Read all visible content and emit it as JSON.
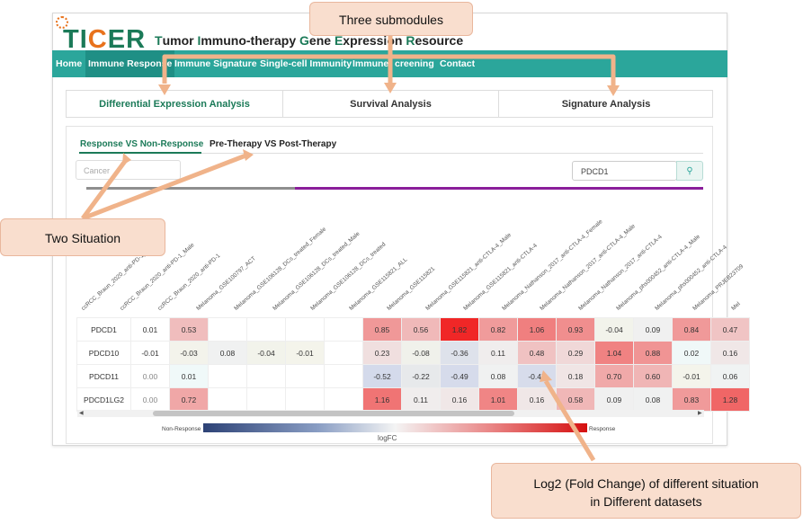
{
  "brand": {
    "logo": "TICER",
    "subtitle_parts": [
      "T",
      "umor ",
      "I",
      "mmuno-therapy ",
      "G",
      "ene ",
      "E",
      "xpression ",
      "R",
      "esource"
    ]
  },
  "nav": [
    "Home",
    "Immune Response",
    "Immune Signature",
    "Single-cell Immunity",
    "Immune Screening",
    "Contact"
  ],
  "nav_visible": [
    "Home",
    "Immune Response",
    "Immune Signature",
    "Single-cell Immunity",
    "Immune",
    "creening",
    "Contact"
  ],
  "tabs": [
    "Differential Expression Analysis",
    "Survival Analysis",
    "Signature Analysis"
  ],
  "subtabs": [
    "Response VS Non-Response",
    "Pre-Therapy VS Post-Therapy"
  ],
  "filter": {
    "cancer_placeholder": "Cancer",
    "search_value": "PDCD1"
  },
  "columns": [
    "ccRCC_Braun_2020_anti-PD-1_ALL",
    "ccRCC_Braun_2020_anti-PD-1_Male",
    "ccRCC_Braun_2020_anti-PD-1",
    "Melanoma_GSE100797_ACT",
    "Melanoma_GSE106128_DCs_treated_Female",
    "Melanoma_GSE106128_DCs_treated_Male",
    "Melanoma_GSE106128_DCs_treated",
    "Melanoma_GSE115821_ALL",
    "Melanoma_GSE115821",
    "Melanoma_GSE115821_anti-CTLA-4_Male",
    "Melanoma_GSE115821_anti-CTLA-4",
    "Melanoma_Nathanson_2017_anti-CTLA-4_Female",
    "Melanoma_Nathanson_2017_anti-CTLA-4_Male",
    "Melanoma_Nathanson_2017_anti-CTLA-4",
    "Melanoma_phs000452_anti-CTLA-4_Male",
    "Melanoma_phs000452_anti-CTLA-4",
    "Melanoma_PRJEB23709",
    "Mel"
  ],
  "rows": [
    {
      "gene": "PDCD1",
      "values": [
        "0.01",
        "0.53",
        "",
        "",
        "",
        "",
        "0.85",
        "0.56",
        "1.82",
        "0.82",
        "1.06",
        "0.93",
        "-0.04",
        "0.09",
        "0.84",
        "0.47"
      ]
    },
    {
      "gene": "PDCD10",
      "values": [
        "-0.01",
        "-0.03",
        "0.08",
        "-0.04",
        "-0.01",
        "",
        "0.23",
        "-0.08",
        "-0.36",
        "0.11",
        "0.48",
        "0.29",
        "1.04",
        "0.88",
        "0.02",
        "0.16"
      ]
    },
    {
      "gene": "PDCD11",
      "values": [
        "0.00",
        "0.01",
        "",
        "",
        "",
        "",
        "-0.52",
        "-0.22",
        "-0.49",
        "0.08",
        "-0.47",
        "0.18",
        "0.70",
        "0.60",
        "-0.01",
        "0.06"
      ]
    },
    {
      "gene": "PDCD1LG2",
      "values": [
        "0.00",
        "0.72",
        "",
        "",
        "",
        "",
        "1.16",
        "0.11",
        "0.16",
        "1.01",
        "0.16",
        "0.58",
        "0.09",
        "0.08",
        "0.83",
        "1.28"
      ]
    }
  ],
  "legend": {
    "left": "Non-Response",
    "right": "Response",
    "label": "logFC"
  },
  "callouts": {
    "top": "Three submodules",
    "left": "Two Situation",
    "bottom_line1": "Log2 (Fold Change) of different situation",
    "bottom_line2": "in Different datasets"
  }
}
